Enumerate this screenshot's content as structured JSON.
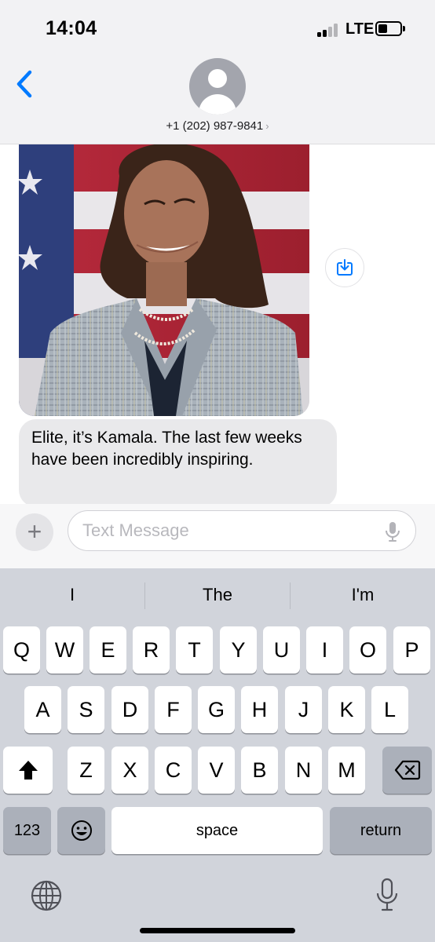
{
  "status_bar": {
    "time": "14:04",
    "network": "LTE"
  },
  "header": {
    "contact": "+1 (202) 987-9841"
  },
  "conversation": {
    "message_text": "Elite, it’s Kamala. The last few weeks have been incredibly inspiring."
  },
  "composer": {
    "placeholder": "Text Message"
  },
  "keyboard": {
    "suggestions": [
      "I",
      "The",
      "I'm"
    ],
    "row1": [
      "Q",
      "W",
      "E",
      "R",
      "T",
      "Y",
      "U",
      "I",
      "O",
      "P"
    ],
    "row2": [
      "A",
      "S",
      "D",
      "F",
      "G",
      "H",
      "J",
      "K",
      "L"
    ],
    "row3": [
      "Z",
      "X",
      "C",
      "V",
      "B",
      "N",
      "M"
    ],
    "numbers_label": "123",
    "space_label": "space",
    "return_label": "return"
  },
  "colors": {
    "accent": "#007aff",
    "bubble": "#e9e9eb",
    "keyboard_bg": "#d1d4db"
  },
  "icons": [
    "back-chevron-icon",
    "contact-avatar-icon",
    "download-icon",
    "plus-icon",
    "microphone-icon",
    "shift-icon",
    "delete-icon",
    "emoji-icon",
    "globe-icon"
  ]
}
